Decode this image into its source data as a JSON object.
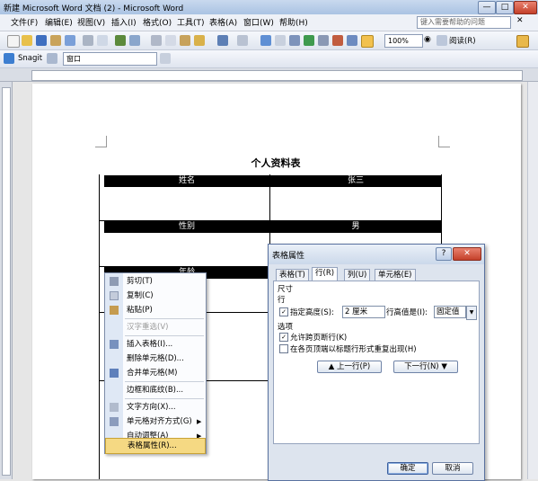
{
  "window": {
    "title": "新建 Microsoft Word 文档 (2) - Microsoft Word",
    "minimize": "—",
    "maximize": "□",
    "close": "✕"
  },
  "menubar": {
    "items": [
      "文件(F)",
      "编辑(E)",
      "视图(V)",
      "插入(I)",
      "格式(O)",
      "工具(T)",
      "表格(A)",
      "窗口(W)",
      "帮助(H)"
    ],
    "help_placeholder": "键入需要帮助的问题"
  },
  "toolbar": {
    "zoom": "100%",
    "read_label": "阅读(R)",
    "icons": [
      "new-icon",
      "open-icon",
      "save-icon",
      "permission-icon",
      "email-icon",
      "print-icon",
      "print-preview-icon",
      "spelling-icon",
      "research-icon",
      "cut-icon",
      "copy-icon",
      "paste-icon",
      "format-painter-icon",
      "undo-icon",
      "redo-icon",
      "hyperlink-icon",
      "tables-borders-icon",
      "insert-table-icon",
      "insert-excel-icon",
      "columns-icon",
      "drawing-icon",
      "document-map-icon",
      "show-hide-icon"
    ]
  },
  "snagit_bar": {
    "label": "Snagit",
    "window_combo": "窗口"
  },
  "document": {
    "title": "个人资料表",
    "rows": [
      {
        "label": "姓名",
        "value": "张三"
      },
      {
        "label": "性别",
        "value": "男"
      },
      {
        "label": "年龄",
        "value": ""
      }
    ]
  },
  "context_menu": {
    "items": [
      {
        "label": "剪切(T)",
        "icon": "cut-icon",
        "disabled": false
      },
      {
        "label": "复制(C)",
        "icon": "copy-icon",
        "disabled": false
      },
      {
        "label": "粘贴(P)",
        "icon": "paste-icon",
        "disabled": false
      },
      {
        "label": "汉字重选(V)",
        "icon": "",
        "disabled": true
      },
      {
        "label": "插入表格(I)...",
        "icon": "insert-table-icon",
        "disabled": false
      },
      {
        "label": "删除单元格(D)...",
        "icon": "",
        "disabled": false
      },
      {
        "label": "合并单元格(M)",
        "icon": "merge-cells-icon",
        "disabled": false
      },
      {
        "label": "边框和底纹(B)...",
        "icon": "",
        "disabled": false
      },
      {
        "label": "文字方向(X)...",
        "icon": "text-direction-icon",
        "disabled": false
      },
      {
        "label": "单元格对齐方式(G)",
        "icon": "cell-alignment-icon",
        "disabled": false,
        "submenu": true
      },
      {
        "label": "自动调整(A)",
        "icon": "",
        "disabled": false,
        "submenu": true
      },
      {
        "label": "表格属性(R)...",
        "icon": "",
        "disabled": false,
        "selected": true
      }
    ]
  },
  "dialog": {
    "title": "表格属性",
    "help": "?",
    "close": "✕",
    "tabs": [
      "表格(T)",
      "行(R)",
      "列(U)",
      "单元格(E)"
    ],
    "active_tab": "行(R)",
    "size_heading": "尺寸",
    "row_heading": "行",
    "specify_height": {
      "label": "指定高度(S):",
      "checked": true,
      "value": "2 厘米"
    },
    "row_height_is": {
      "label": "行高值是(I):",
      "value": "固定值"
    },
    "options_heading": "选项",
    "allow_break": {
      "label": "允许跨页断行(K)",
      "checked": true
    },
    "repeat_header": {
      "label": "在各页顶端以标题行形式重复出现(H)",
      "checked": false
    },
    "prev_row": "▲ 上一行(P)",
    "next_row": "下一行(N) ▼",
    "ok": "确定",
    "cancel": "取消"
  }
}
